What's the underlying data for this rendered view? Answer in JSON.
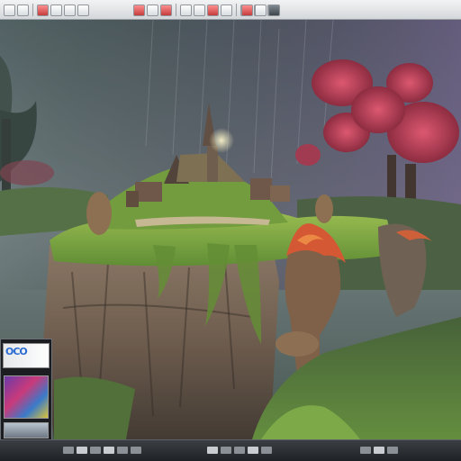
{
  "toolbar": {
    "icons": [
      "toolbar-icon",
      "toolbar-icon",
      "toolbar-icon",
      "toolbar-icon",
      "toolbar-icon",
      "toolbar-icon",
      "toolbar-icon",
      "toolbar-icon"
    ]
  },
  "thumbnail": {
    "label": "OCO"
  },
  "colors": {
    "toolbar_bg": "#d4d7da",
    "status_bg": "#2a2e30",
    "accent_red": "#c43c3c"
  }
}
